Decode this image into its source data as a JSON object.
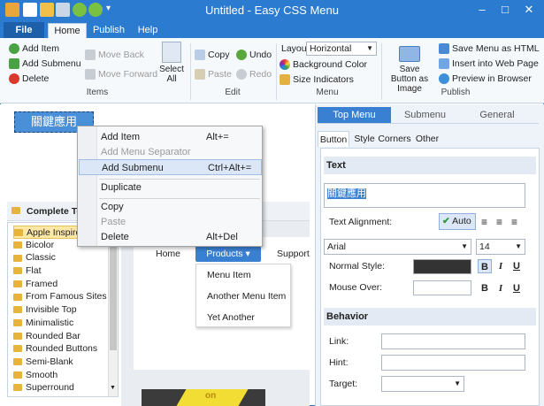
{
  "window": {
    "title": "Untitled - Easy CSS Menu"
  },
  "ribbon": {
    "tabs": [
      "File",
      "Home",
      "Publish",
      "Help"
    ],
    "items_group": {
      "add_item": "Add Item",
      "add_submenu": "Add Submenu",
      "delete": "Delete",
      "move_back": "Move Back",
      "move_forward": "Move Forward",
      "select_all": "Select All",
      "label": "Items"
    },
    "edit_group": {
      "copy": "Copy",
      "undo": "Undo",
      "paste": "Paste",
      "redo": "Redo",
      "label": "Edit"
    },
    "menu_group": {
      "layout_label": "Layout",
      "layout_value": "Horizontal",
      "background_color": "Background Color",
      "size_indicators": "Size Indicators",
      "label": "Menu"
    },
    "publish_group": {
      "save_button_as_image": "Save Button as Image",
      "save_menu_as_html": "Save Menu as HTML",
      "insert_into_web_page": "Insert into Web Page",
      "preview_in_browser": "Preview in Browser",
      "label": "Publish"
    }
  },
  "canvas": {
    "selected_button_text": "關鍵應用"
  },
  "context_menu": [
    {
      "label": "Add Item",
      "shortcut": "Alt+="
    },
    {
      "label": "Add Menu Separator",
      "shortcut": "",
      "disabled": true
    },
    {
      "label": "Add Submenu",
      "shortcut": "Ctrl+Alt+="
    },
    {
      "label": "Duplicate",
      "shortcut": ""
    },
    {
      "label": "Copy",
      "shortcut": ""
    },
    {
      "label": "Paste",
      "shortcut": "",
      "disabled": true
    },
    {
      "label": "Delete",
      "shortcut": "Alt+Del"
    }
  ],
  "themes": {
    "header": "Complete Te",
    "items": [
      "Apple Inspired",
      "Bicolor",
      "Classic",
      "Flat",
      "Framed",
      "From Famous Sites",
      "Invisible Top",
      "Minimalistic",
      "Rounded Bar",
      "Rounded Buttons",
      "Semi-Blank",
      "Smooth",
      "Superround"
    ],
    "selected": "Apple Inspired"
  },
  "preview": {
    "nav": [
      "Home",
      "Products ▾",
      "Support"
    ],
    "submenu": [
      "Menu Item",
      "Another Menu Item",
      "Yet Another"
    ],
    "banner_text": "on"
  },
  "props": {
    "tabs": [
      "Top Menu",
      "Submenu",
      "General"
    ],
    "subtabs": [
      "Button",
      "Style",
      "Corners",
      "Other"
    ],
    "text_section": "Text",
    "text_value": "關鍵應用",
    "text_alignment_label": "Text Alignment:",
    "auto_label": "Auto",
    "font": "Arial",
    "size": "14",
    "normal_style_label": "Normal Style:",
    "mouse_over_label": "Mouse Over:",
    "normal_color": "#333333",
    "behavior_section": "Behavior",
    "link_label": "Link:",
    "hint_label": "Hint:",
    "target_label": "Target:"
  },
  "colors": {
    "accent": "#2b7bd0",
    "selected_button": "#4a90d9"
  }
}
